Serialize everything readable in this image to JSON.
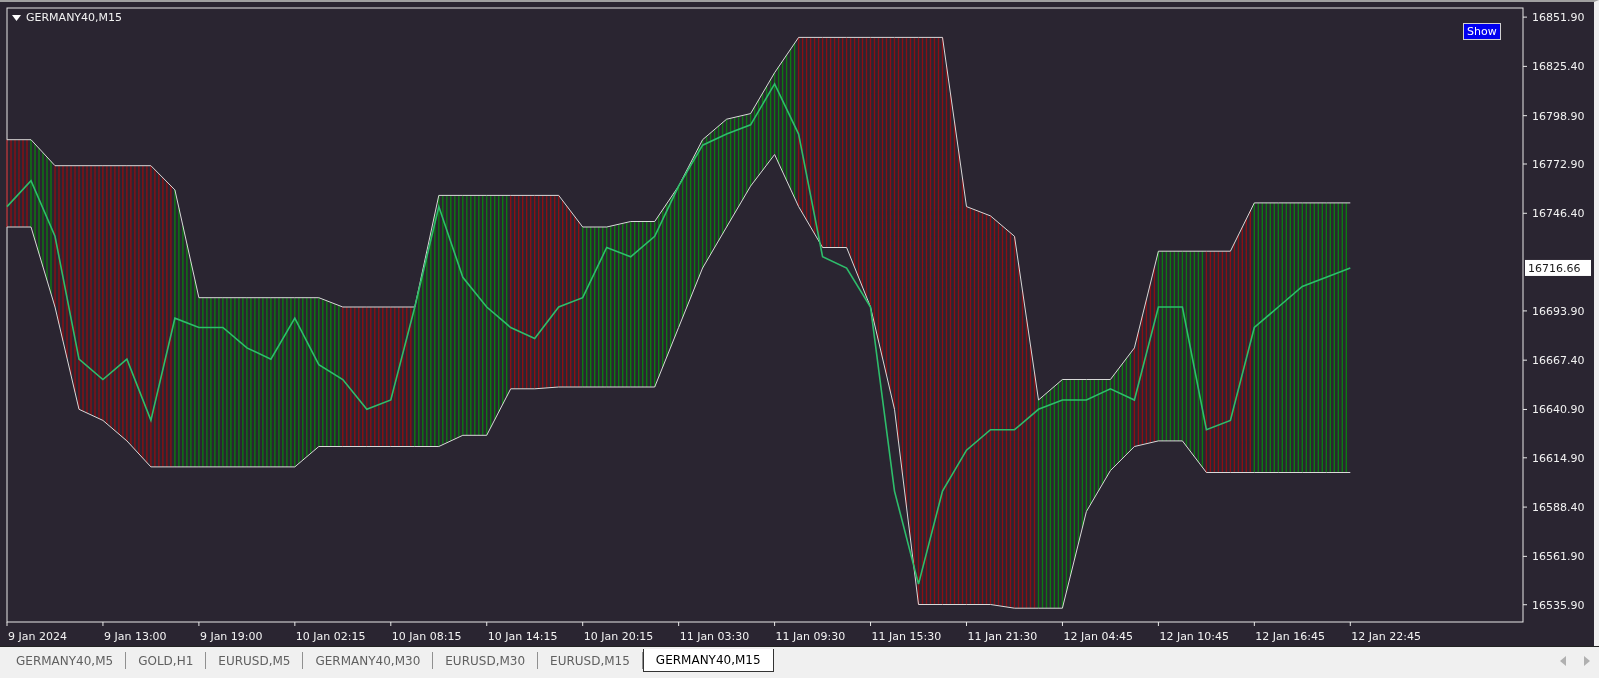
{
  "chart": {
    "title": "GERMANY40,M15",
    "show_button": "Show",
    "current_price": "16716.66",
    "price_labels": [
      "16851.90",
      "16825.40",
      "16798.90",
      "16772.90",
      "16746.40",
      "16693.90",
      "16667.40",
      "16640.90",
      "16614.90",
      "16588.40",
      "16561.90",
      "16535.90"
    ],
    "time_labels": [
      "9 Jan 2024",
      "9 Jan 13:00",
      "9 Jan 19:00",
      "10 Jan 02:15",
      "10 Jan 08:15",
      "10 Jan 14:15",
      "10 Jan 20:15",
      "11 Jan 03:30",
      "11 Jan 09:30",
      "11 Jan 15:30",
      "11 Jan 21:30",
      "12 Jan 04:45",
      "12 Jan 10:45",
      "12 Jan 16:45",
      "12 Jan 22:45"
    ]
  },
  "tabs": [
    {
      "label": "GERMANY40,M5",
      "selected": false
    },
    {
      "label": "GOLD,H1",
      "selected": false
    },
    {
      "label": "EURUSD,M5",
      "selected": false
    },
    {
      "label": "GERMANY40,M30",
      "selected": false
    },
    {
      "label": "EURUSD,M30",
      "selected": false
    },
    {
      "label": "EURUSD,M15",
      "selected": false
    },
    {
      "label": "GERMANY40,M15",
      "selected": true
    }
  ]
}
